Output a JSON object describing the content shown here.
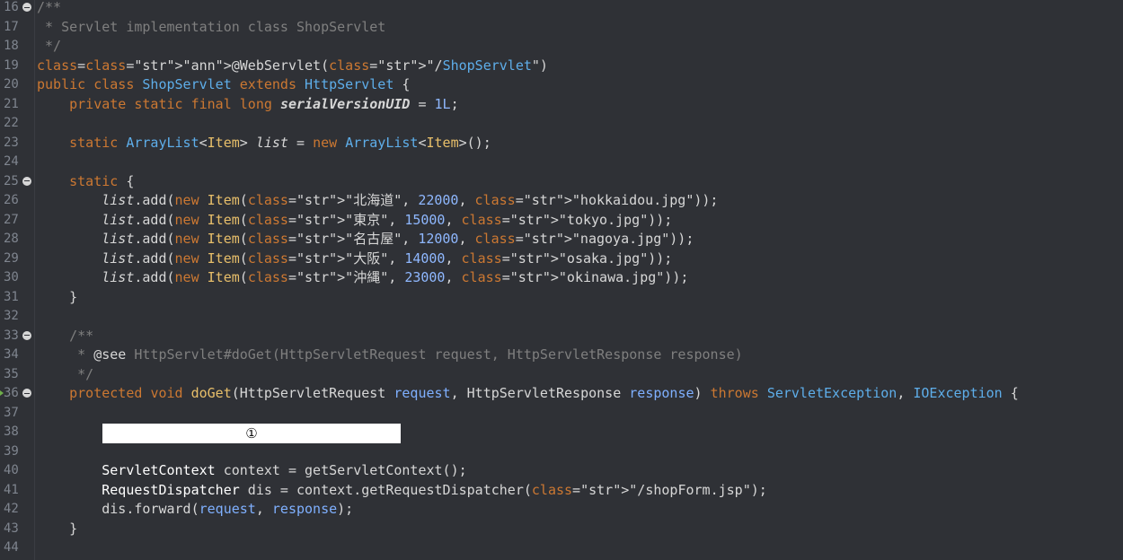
{
  "editor": {
    "lines": [
      {
        "n": "16",
        "fold": true,
        "code": "/**"
      },
      {
        "n": "17",
        "code": " * Servlet implementation class ShopServlet"
      },
      {
        "n": "18",
        "code": " */"
      },
      {
        "n": "19",
        "code": "@WebServlet(\"/ShopServlet\")"
      },
      {
        "n": "20",
        "code": "public class ShopServlet extends HttpServlet {"
      },
      {
        "n": "21",
        "code": "    private static final long serialVersionUID = 1L;"
      },
      {
        "n": "22",
        "code": ""
      },
      {
        "n": "23",
        "code": "    static ArrayList<Item> list = new ArrayList<Item>();"
      },
      {
        "n": "24",
        "code": ""
      },
      {
        "n": "25",
        "fold": true,
        "code": "    static {"
      },
      {
        "n": "26",
        "code": "        list.add(new Item(\"北海道\", 22000, \"hokkaidou.jpg\"));"
      },
      {
        "n": "27",
        "code": "        list.add(new Item(\"東京\", 15000, \"tokyo.jpg\"));"
      },
      {
        "n": "28",
        "code": "        list.add(new Item(\"名古屋\", 12000, \"nagoya.jpg\"));"
      },
      {
        "n": "29",
        "code": "        list.add(new Item(\"大阪\", 14000, \"osaka.jpg\"));"
      },
      {
        "n": "30",
        "code": "        list.add(new Item(\"沖縄\", 23000, \"okinawa.jpg\"));"
      },
      {
        "n": "31",
        "code": "    }"
      },
      {
        "n": "32",
        "code": ""
      },
      {
        "n": "33",
        "fold": true,
        "code": "    /**"
      },
      {
        "n": "34",
        "code": "     * @see HttpServlet#doGet(HttpServletRequest request, HttpServletResponse response)"
      },
      {
        "n": "35",
        "code": "     */"
      },
      {
        "n": "36",
        "fold": true,
        "marker": true,
        "code": "    protected void doGet(HttpServletRequest request, HttpServletResponse response) throws ServletException, IOException {"
      },
      {
        "n": "37",
        "code": ""
      },
      {
        "n": "38",
        "code": ""
      },
      {
        "n": "39",
        "code": ""
      },
      {
        "n": "40",
        "code": "        ServletContext context = getServletContext();"
      },
      {
        "n": "41",
        "code": "        RequestDispatcher dis = context.getRequestDispatcher(\"/shopForm.jsp\");"
      },
      {
        "n": "42",
        "code": "        dis.forward(request, response);"
      },
      {
        "n": "43",
        "code": "    }"
      },
      {
        "n": "44",
        "code": ""
      }
    ],
    "placeholder_label": "①"
  },
  "colors": {
    "background": "#2f3136",
    "line_number": "#7f858f",
    "keyword": "#cc7832",
    "comment": "#7f7f7f",
    "type": "#5eaeea",
    "string": "#e8bf6a",
    "number": "#8fb8ff",
    "placeholder_box": "#ffffff"
  }
}
